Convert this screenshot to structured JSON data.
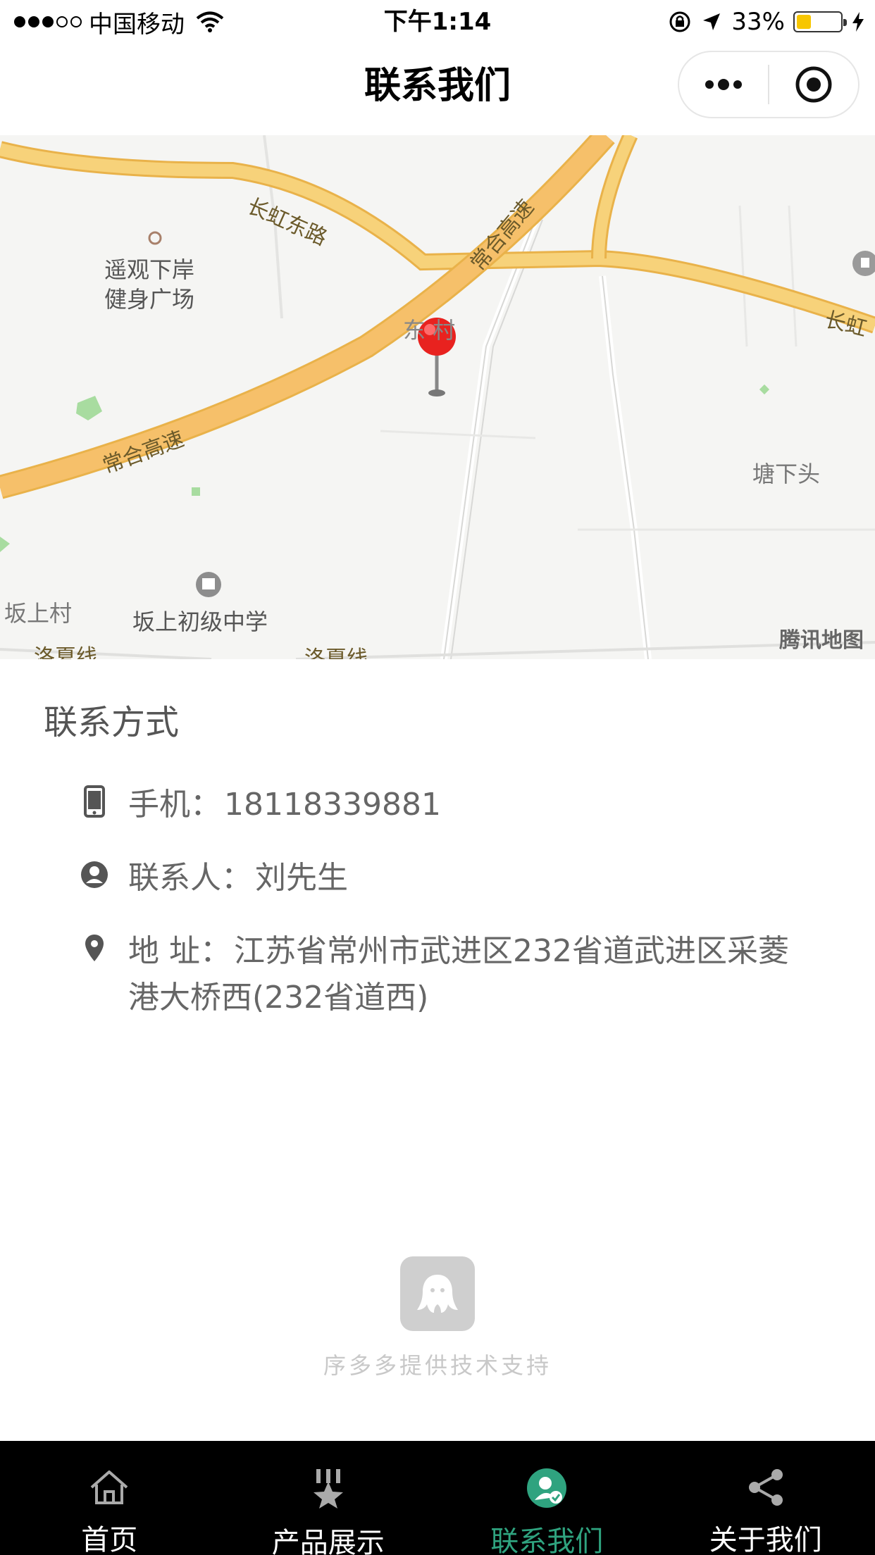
{
  "status_bar": {
    "carrier": "中国移动",
    "time": "下午1:14",
    "battery_percent": "33%",
    "battery_level": 0.33
  },
  "nav": {
    "title": "联系我们",
    "more_icon": "more-dots-icon",
    "close_icon": "target-close-icon"
  },
  "map": {
    "labels": {
      "road_changhong_east": "长虹东路",
      "road_changhong_right": "长虹",
      "road_highway_top": "常合高速",
      "road_highway_bottom": "常合高速",
      "road_luoxia_left": "洛夏线",
      "road_luoxia_mid": "洛夏线",
      "poi_yaoguan": "遥观下岸\n健身广场",
      "poi_village": "东 村",
      "poi_tangxiatou": "塘下头",
      "poi_banshangcun": "坂上村",
      "poi_school": "坂上初级中学",
      "credit": "腾讯地图"
    },
    "colors": {
      "road": "#f7c66b",
      "road_edge": "#e9b24a",
      "pin": "#e8221f",
      "background": "#f5f5f3"
    }
  },
  "contact": {
    "title": "联系方式",
    "phone_label": "手机：",
    "phone": "18118339881",
    "person_label": "联系人：",
    "person": "刘先生",
    "address_label": "地 址：",
    "address": "江苏省常州市武进区232省道武进区采菱港大桥西(232省道西)"
  },
  "support": {
    "text": "序多多提供技术支持"
  },
  "tabs": [
    {
      "label": "首页",
      "icon": "home-icon",
      "active": false
    },
    {
      "label": "产品展示",
      "icon": "product-badge-icon",
      "active": false
    },
    {
      "label": "联系我们",
      "icon": "contact-user-icon",
      "active": true
    },
    {
      "label": "关于我们",
      "icon": "share-icon",
      "active": false
    }
  ],
  "colors": {
    "accent": "#2fa37f",
    "tab_bg": "#000000"
  }
}
